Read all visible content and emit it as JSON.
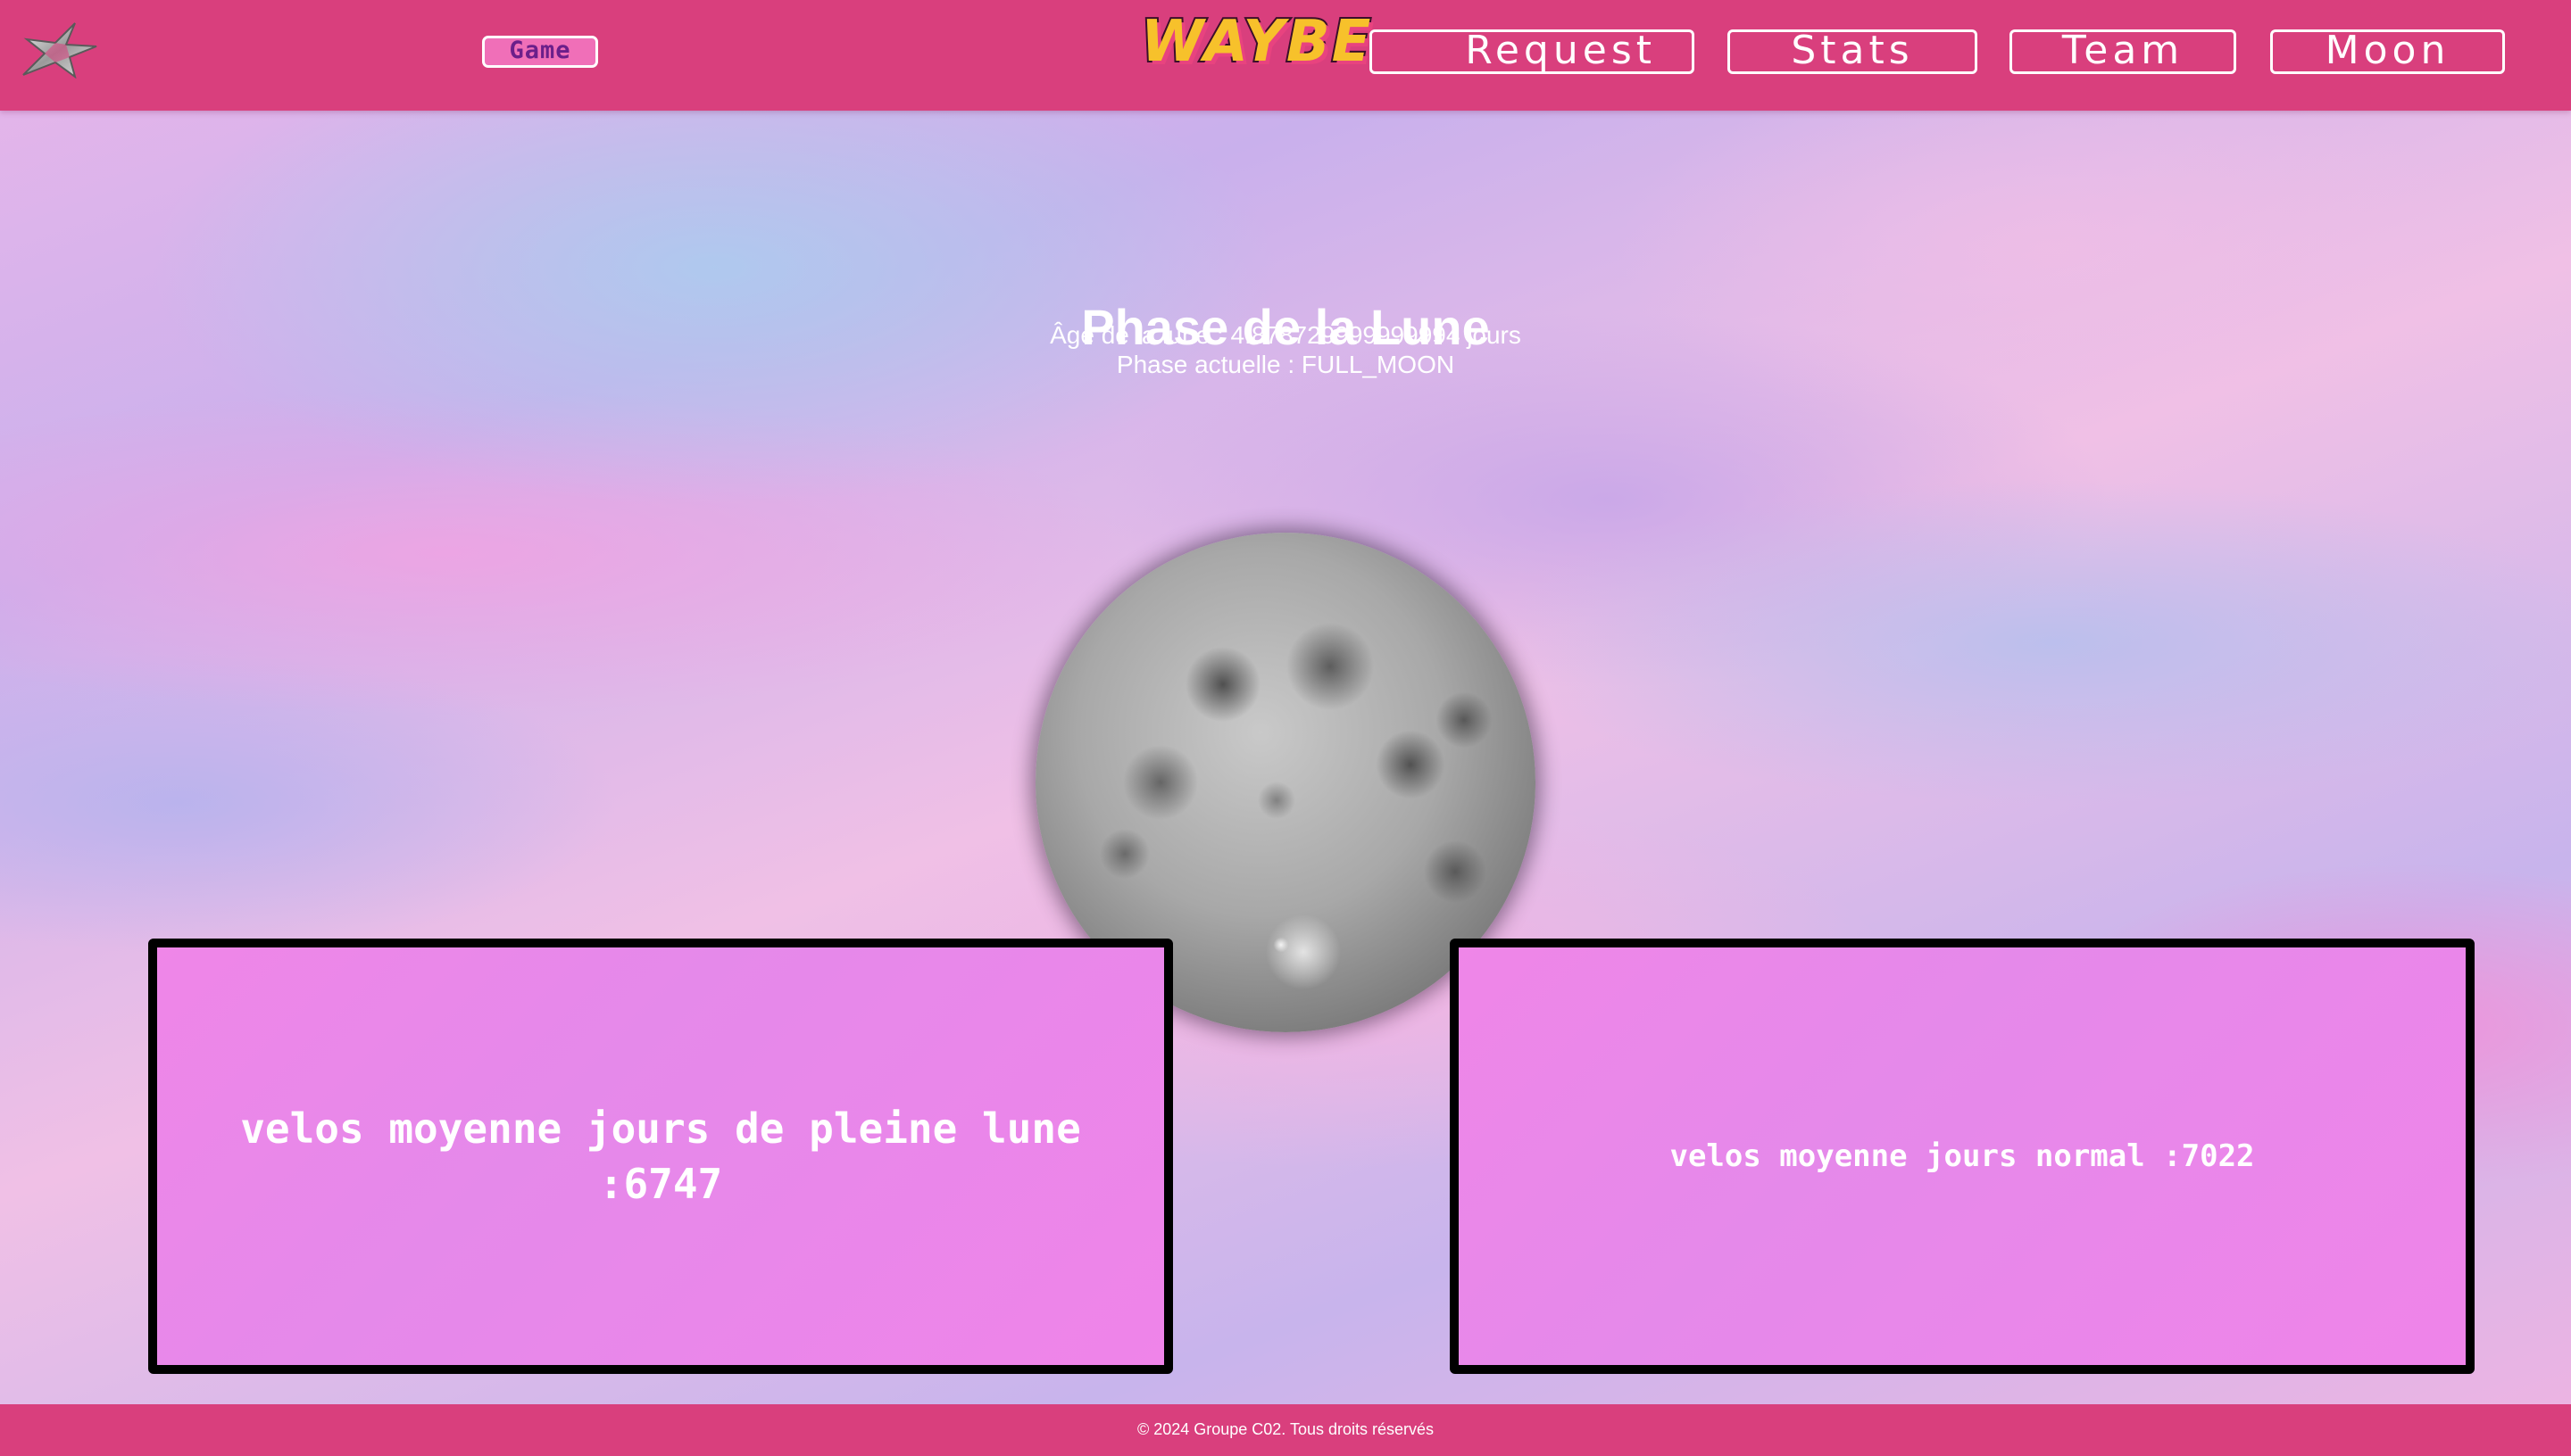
{
  "header": {
    "logo_icon": "star-logo-icon",
    "game_label": "Game",
    "brand_text": "WAYBE",
    "nav": {
      "request": "Request",
      "stats": "Stats",
      "team": "Team",
      "moon": "Moon"
    }
  },
  "main": {
    "title": "Phase de la Lune",
    "age_line": "Âge de la lune : 4.878729999999994 jours",
    "phase_line": "Phase actuelle : FULL_MOON",
    "moon_image": "full-moon-image",
    "stats": {
      "full_moon_text": "velos moyenne jours de pleine lune\n:6747",
      "normal_text": "velos moyenne jours normal :7022"
    }
  },
  "footer": {
    "copyright": "© 2024 Groupe C02. Tous droits réservés"
  },
  "colors": {
    "header_bg": "#d93f7d",
    "footer_bg": "#d93f7d",
    "stat_box_bg": "#e589ea",
    "text": "#ffffff"
  }
}
